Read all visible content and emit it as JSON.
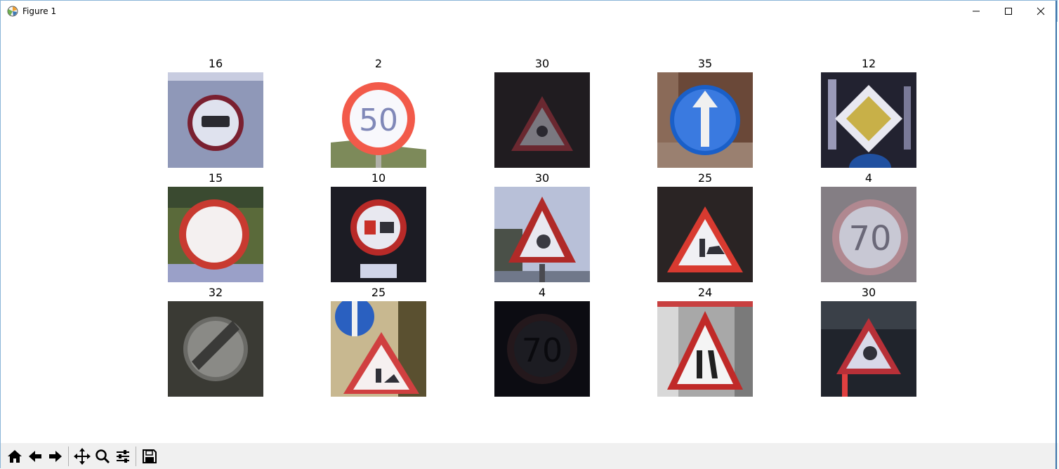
{
  "window": {
    "title": "Figure 1"
  },
  "icons": {
    "app": "matplotlib-icon",
    "minimize": "minimize-icon",
    "maximize": "maximize-icon",
    "close": "close-icon"
  },
  "figure": {
    "rows": [
      [
        {
          "label": "16",
          "sign": "no-trucks"
        },
        {
          "label": "2",
          "sign": "speed-50"
        },
        {
          "label": "30",
          "sign": "ice-snow"
        },
        {
          "label": "35",
          "sign": "ahead-only"
        },
        {
          "label": "12",
          "sign": "priority-road"
        }
      ],
      [
        {
          "label": "15",
          "sign": "no-vehicles"
        },
        {
          "label": "10",
          "sign": "no-passing-trucks"
        },
        {
          "label": "30",
          "sign": "ice-snow"
        },
        {
          "label": "25",
          "sign": "road-work"
        },
        {
          "label": "4",
          "sign": "speed-70"
        }
      ],
      [
        {
          "label": "32",
          "sign": "end-of-limits"
        },
        {
          "label": "25",
          "sign": "road-work"
        },
        {
          "label": "4",
          "sign": "speed-70"
        },
        {
          "label": "24",
          "sign": "road-narrows-right"
        },
        {
          "label": "30",
          "sign": "ice-snow"
        }
      ]
    ],
    "sign_text": {
      "speed_50": "50",
      "speed_70a": "70",
      "speed_70b": "70"
    }
  },
  "toolbar": {
    "items": [
      {
        "name": "home-button",
        "icon": "home-icon"
      },
      {
        "name": "back-button",
        "icon": "arrow-left-icon"
      },
      {
        "name": "forward-button",
        "icon": "arrow-right-icon"
      },
      {
        "name": "pan-button",
        "icon": "move-icon"
      },
      {
        "name": "zoom-button",
        "icon": "zoom-icon"
      },
      {
        "name": "configure-subplots-button",
        "icon": "sliders-icon"
      },
      {
        "name": "save-button",
        "icon": "floppy-disk-icon"
      }
    ]
  }
}
